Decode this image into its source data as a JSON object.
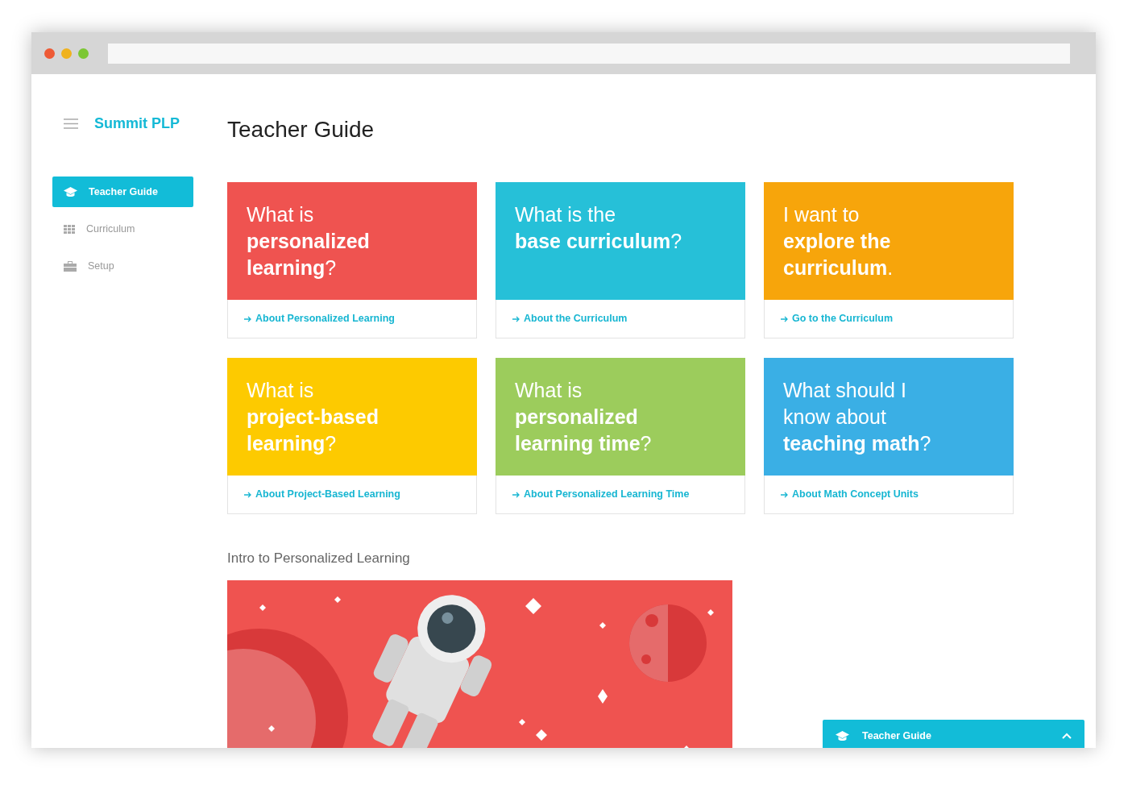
{
  "browser": {
    "window_controls": [
      {
        "color": "#ee5a35"
      },
      {
        "color": "#f0b21e"
      },
      {
        "color": "#7cc734"
      }
    ]
  },
  "sidebar": {
    "brand": "Summit PLP",
    "items": [
      {
        "label": "Teacher Guide",
        "kind": "cap",
        "selected": true
      },
      {
        "label": "Curriculum",
        "kind": "grid",
        "selected": false
      },
      {
        "label": "Setup",
        "kind": "case",
        "selected": false
      }
    ]
  },
  "page_title": "Teacher Guide",
  "cards": [
    {
      "title": "What is\n**personalized**\n**learning**?",
      "color": "#ef5350",
      "link": "About Personalized Learning"
    },
    {
      "title": "What is the\n**base curriculum**?",
      "color": "#26c0d8",
      "link": "About the Curriculum"
    },
    {
      "title": "I want to\n**explore the**\n**curriculum**.",
      "color": "#f7a50b",
      "link": "Go to the Curriculum"
    },
    {
      "title": "What is\n**project-based**\n**learning**?",
      "color": "#fdca00",
      "link": "About Project-Based Learning"
    },
    {
      "title": "What is\n**personalized**\n**learning time**?",
      "color": "#9ccc5c",
      "link": "About Personalized Learning Time"
    },
    {
      "title": "What should I\nknow about\n**teaching math**?",
      "color": "#3aafe5",
      "link": "About Math Concept Units"
    }
  ],
  "video_section": {
    "title": "Intro to Personalized Learning"
  },
  "bottom_bar": {
    "label": "Teacher Guide",
    "expanded": false
  }
}
